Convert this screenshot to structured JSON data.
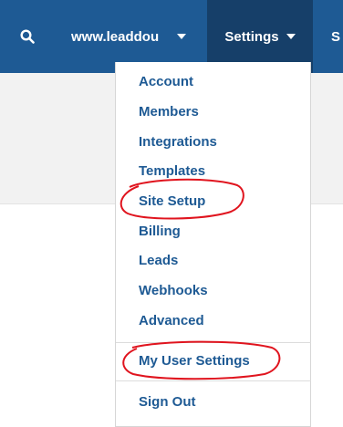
{
  "navbar": {
    "site_label": "www.leaddou",
    "settings_label": "Settings",
    "next_tab_label": "S"
  },
  "dropdown": {
    "items": [
      {
        "label": "Account"
      },
      {
        "label": "Members"
      },
      {
        "label": "Integrations"
      },
      {
        "label": "Templates"
      },
      {
        "label": "Site Setup"
      },
      {
        "label": "Billing"
      },
      {
        "label": "Leads"
      },
      {
        "label": "Webhooks"
      },
      {
        "label": "Advanced"
      },
      {
        "label": "My User Settings"
      },
      {
        "label": "Sign Out"
      }
    ]
  },
  "colors": {
    "navbar": "#1e5a94",
    "active_tab": "#163f69",
    "link": "#1e5a94",
    "annotation": "#e0141e"
  }
}
